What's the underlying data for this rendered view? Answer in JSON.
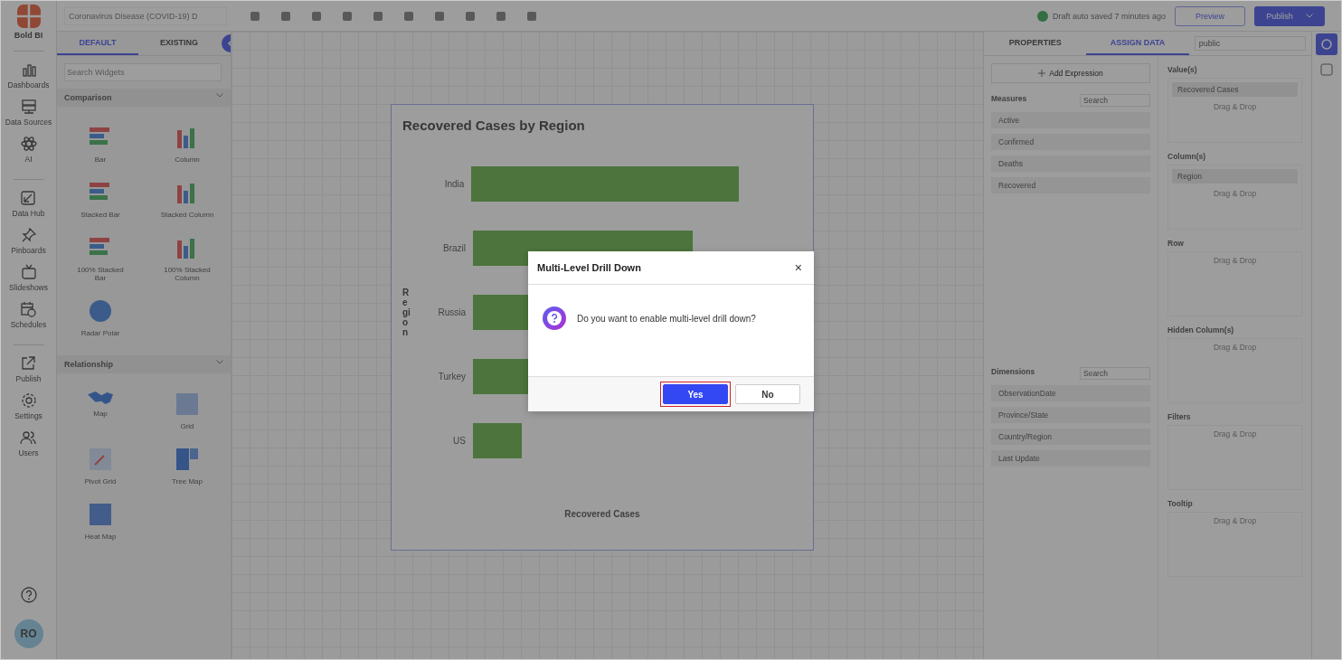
{
  "nav": {
    "logo": "Bold BI",
    "avatar": "RO",
    "items": [
      {
        "label": "Dashboards",
        "kind": "bars"
      },
      {
        "label": "Data Sources",
        "kind": "server"
      },
      {
        "label": "AI",
        "kind": "atom"
      },
      {
        "label": "Data Hub",
        "kind": "hub"
      },
      {
        "label": "Pinboards",
        "kind": "pin"
      },
      {
        "label": "Slideshows",
        "kind": "tv"
      },
      {
        "label": "Schedules",
        "kind": "calendar"
      },
      {
        "label": "Publish",
        "kind": "publish"
      },
      {
        "label": "Settings",
        "kind": "gear"
      },
      {
        "label": "Users",
        "kind": "users"
      }
    ]
  },
  "top_bar": {
    "title": "Coronavirus Disease (COVID-19) D",
    "status": "Draft auto saved 7 minutes ago",
    "preview": "Preview",
    "publish": "Publish"
  },
  "widgets": {
    "tabs": [
      {
        "label": "DEFAULT",
        "selected": true
      },
      {
        "label": "EXISTING",
        "selected": false
      }
    ],
    "search": {
      "placeholder": "Search Widgets"
    },
    "sections": [
      {
        "title": "Comparison",
        "items": [
          {
            "label": "Bar",
            "kind": "hbar"
          },
          {
            "label": "Column",
            "kind": "column"
          },
          {
            "label": "Stacked Bar",
            "kind": "hbar"
          },
          {
            "label": "Stacked Column",
            "kind": "column"
          },
          {
            "label": "100% Stacked Bar",
            "kind": "hbar"
          },
          {
            "label": "100% Stacked Column",
            "kind": "column"
          },
          {
            "label": "Radar Polar",
            "kind": "radar"
          }
        ]
      },
      {
        "title": "Relationship",
        "items": [
          {
            "label": "Map",
            "kind": "map"
          },
          {
            "label": "Grid",
            "kind": "grid"
          },
          {
            "label": "Pivot Grid",
            "kind": "pivot"
          },
          {
            "label": "Tree Map",
            "kind": "tree"
          },
          {
            "label": "Heat Map",
            "kind": "heat"
          }
        ]
      }
    ]
  },
  "chart": {
    "title": "Recovered Cases by Region",
    "ylabel": "Region",
    "xlabel": "Recovered Cases",
    "categories": [
      "India",
      "Brazil",
      "Russia",
      "Turkey",
      "US"
    ]
  },
  "properties": {
    "tabs": [
      {
        "label": "PROPERTIES",
        "selected": false
      },
      {
        "label": "ASSIGN DATA",
        "selected": true
      }
    ],
    "source": "public",
    "add_expression": "Add Expression",
    "measures": {
      "title": "Measures",
      "search": "Search",
      "items": [
        "Active",
        "Confirmed",
        "Deaths",
        "Recovered"
      ]
    },
    "dimensions": {
      "title": "Dimensions",
      "search": "Search",
      "items": [
        "ObservationDate",
        "Province/State",
        "Country/Region",
        "Last Update"
      ]
    },
    "wells": [
      {
        "title": "Value(s)",
        "field": "Recovered Cases",
        "drop": "Drag & Drop"
      },
      {
        "title": "Column(s)",
        "field": "Region",
        "drop": "Drag & Drop"
      },
      {
        "title": "Row",
        "drop": "Drag & Drop"
      },
      {
        "title": "Hidden Column(s)",
        "drop": "Drag & Drop"
      },
      {
        "title": "Filters",
        "drop": "Drag & Drop"
      },
      {
        "title": "Tooltip",
        "drop": "Drag & Drop"
      }
    ]
  },
  "dialog": {
    "title": "Multi-Level Drill Down",
    "close": "×",
    "message": "Do you want to enable multi-level drill down?",
    "buttons": [
      {
        "label": "Yes",
        "primary": true,
        "highlighted": true
      },
      {
        "label": "No",
        "primary": false,
        "highlighted": false
      }
    ]
  }
}
